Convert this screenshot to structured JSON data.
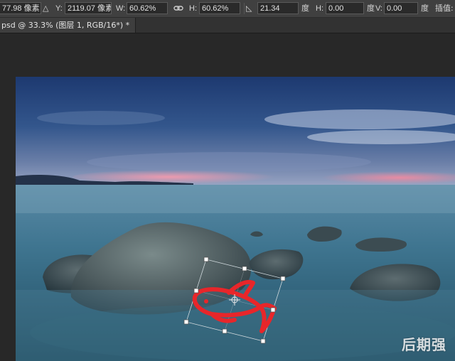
{
  "options_bar": {
    "x_value": "77.98 像素",
    "y_label": "Y:",
    "y_value": "2119.07 像素",
    "w_label": "W:",
    "w_value": "60.62%",
    "h_label": "H:",
    "h_value": "60.62%",
    "angle_value": "21.34",
    "angle_unit": "度",
    "hskew_label": "H:",
    "hskew_value": "0.00",
    "hskew_unit": "度",
    "vskew_label": "V:",
    "vskew_value": "0.00",
    "vskew_unit": "度",
    "interpolation_label": "插值:"
  },
  "document": {
    "tab_title": "psd @ 33.3% (图层 1, RGB/16*) *"
  },
  "watermark": {
    "text": "后期强"
  },
  "colors": {
    "transform_stroke": "#e8262a",
    "sky_top": "#1d3970",
    "sunset": "#e98aa0",
    "sea": "#3b6f86"
  }
}
